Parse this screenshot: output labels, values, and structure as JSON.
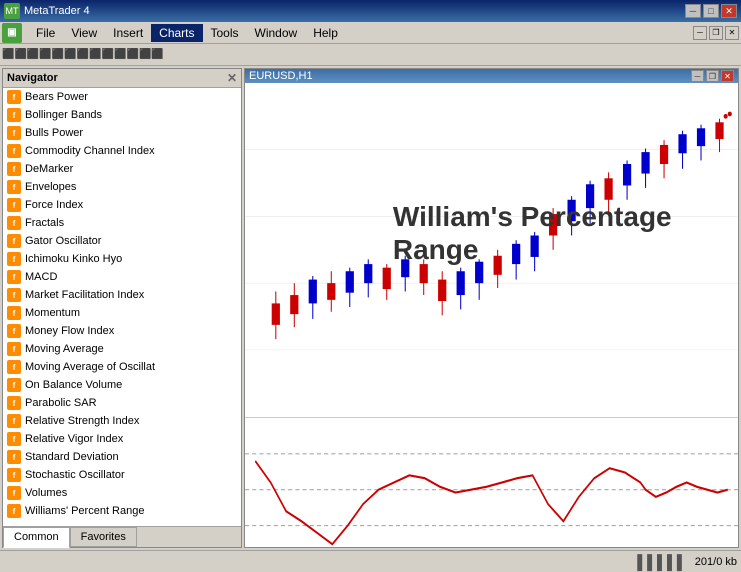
{
  "titleBar": {
    "title": "MetaTrader 4",
    "icon": "MT",
    "controls": {
      "minimize": "─",
      "maximize": "□",
      "close": "✕"
    }
  },
  "menuBar": {
    "items": [
      "File",
      "View",
      "Insert",
      "Charts",
      "Tools",
      "Window",
      "Help"
    ],
    "activeItem": "Charts",
    "innerControls": {
      "minimize": "─",
      "restore": "❐",
      "close": "✕"
    }
  },
  "navigator": {
    "title": "Navigator",
    "closeBtn": "✕",
    "items": [
      {
        "label": "Bears Power",
        "icon": "f"
      },
      {
        "label": "Bollinger Bands",
        "icon": "f"
      },
      {
        "label": "Bulls Power",
        "icon": "f"
      },
      {
        "label": "Commodity Channel Index",
        "icon": "f"
      },
      {
        "label": "DeMarker",
        "icon": "f"
      },
      {
        "label": "Envelopes",
        "icon": "f"
      },
      {
        "label": "Force Index",
        "icon": "f"
      },
      {
        "label": "Fractals",
        "icon": "f"
      },
      {
        "label": "Gator Oscillator",
        "icon": "f"
      },
      {
        "label": "Ichimoku Kinko Hyo",
        "icon": "f"
      },
      {
        "label": "MACD",
        "icon": "f"
      },
      {
        "label": "Market Facilitation Index",
        "icon": "f"
      },
      {
        "label": "Momentum",
        "icon": "f"
      },
      {
        "label": "Money Flow Index",
        "icon": "f"
      },
      {
        "label": "Moving Average",
        "icon": "f"
      },
      {
        "label": "Moving Average of Oscillat",
        "icon": "f"
      },
      {
        "label": "On Balance Volume",
        "icon": "f"
      },
      {
        "label": "Parabolic SAR",
        "icon": "f"
      },
      {
        "label": "Relative Strength Index",
        "icon": "f"
      },
      {
        "label": "Relative Vigor Index",
        "icon": "f"
      },
      {
        "label": "Standard Deviation",
        "icon": "f"
      },
      {
        "label": "Stochastic Oscillator",
        "icon": "f"
      },
      {
        "label": "Volumes",
        "icon": "f"
      },
      {
        "label": "Williams' Percent Range",
        "icon": "f"
      }
    ],
    "tabs": [
      {
        "label": "Common",
        "active": true
      },
      {
        "label": "Favorites",
        "active": false
      }
    ]
  },
  "chart": {
    "innerTitle": "EURUSD,H1",
    "label": "William's Percentage\nRange",
    "controls": {
      "minimize": "─",
      "restore": "❐",
      "close": "✕"
    }
  },
  "statusBar": {
    "barIcon": "▌▌▌▌▌",
    "memoryLabel": "201/0 kb"
  }
}
